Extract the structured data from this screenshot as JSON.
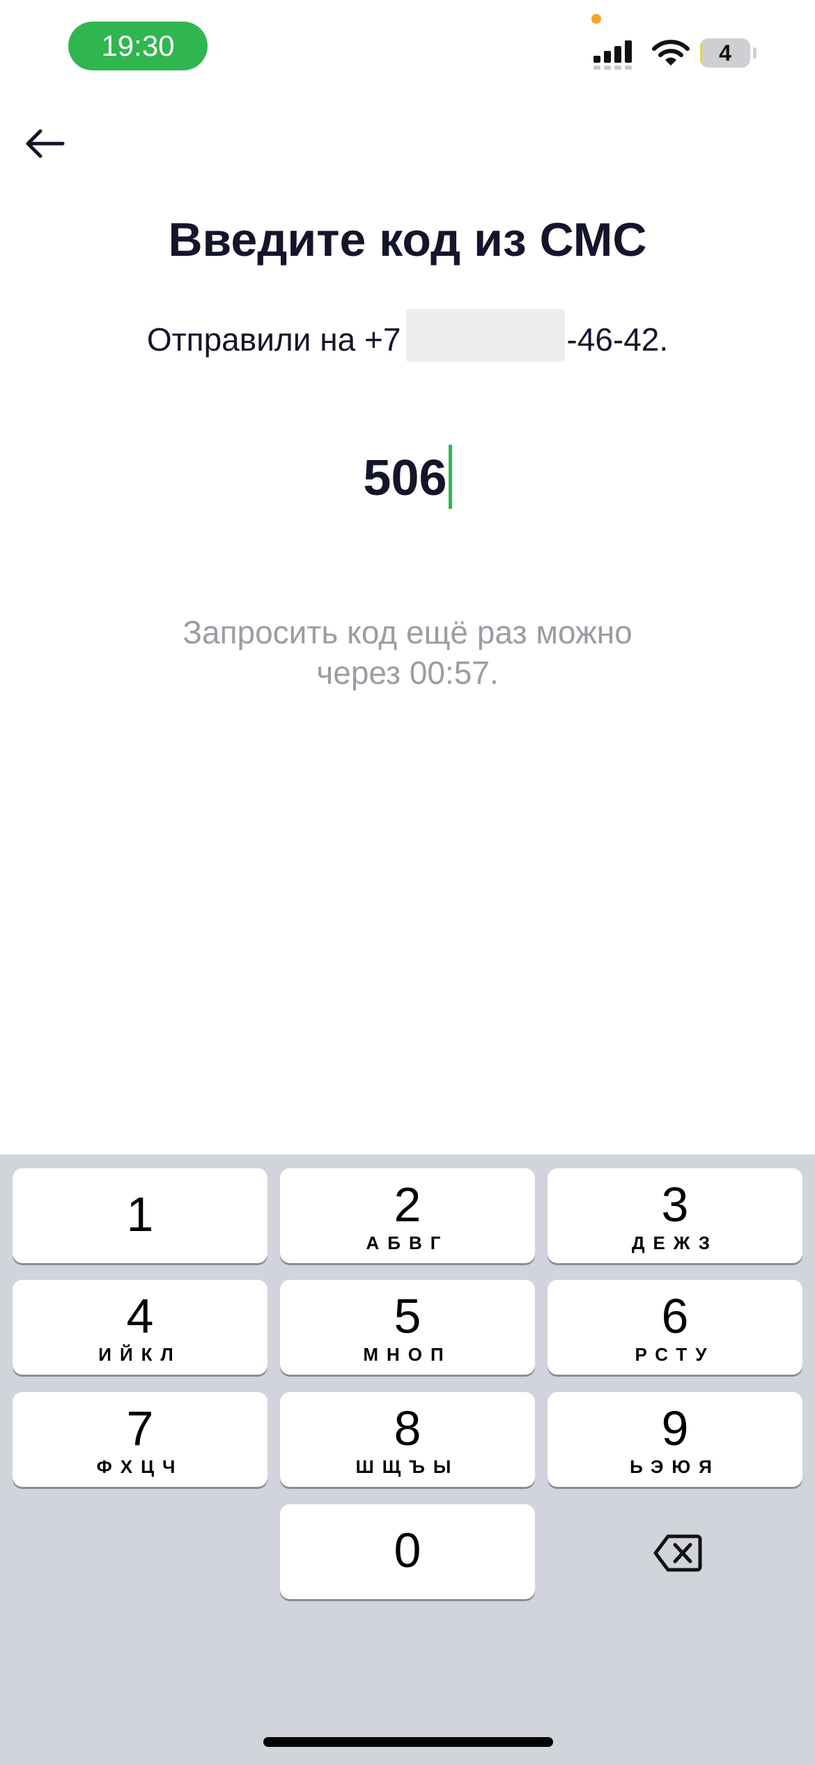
{
  "status_bar": {
    "time": "19:30",
    "battery_level": "4",
    "battery_fraction": 0.04,
    "signal_icon": "cellular-signal-icon",
    "wifi_icon": "wifi-icon",
    "accent_color": "#2fb64f"
  },
  "nav": {
    "back_icon": "arrow-left-icon"
  },
  "screen": {
    "title": "Введите код из СМС",
    "sent_prefix": "Отправили на +7",
    "sent_suffix": "-46-42.",
    "code_value": "506",
    "resend_text": "Запросить код ещё раз можно через 00:57."
  },
  "keypad": {
    "keys": [
      {
        "num": "1",
        "letters": ""
      },
      {
        "num": "2",
        "letters": "АБВГ"
      },
      {
        "num": "3",
        "letters": "ДЕЖЗ"
      },
      {
        "num": "4",
        "letters": "ИЙКЛ"
      },
      {
        "num": "5",
        "letters": "МНОП"
      },
      {
        "num": "6",
        "letters": "РСТУ"
      },
      {
        "num": "7",
        "letters": "ФХЦЧ"
      },
      {
        "num": "8",
        "letters": "ШЩЪЫ"
      },
      {
        "num": "9",
        "letters": "ЬЭЮЯ"
      },
      {
        "num": "0",
        "letters": ""
      }
    ],
    "delete_icon": "backspace-icon"
  }
}
